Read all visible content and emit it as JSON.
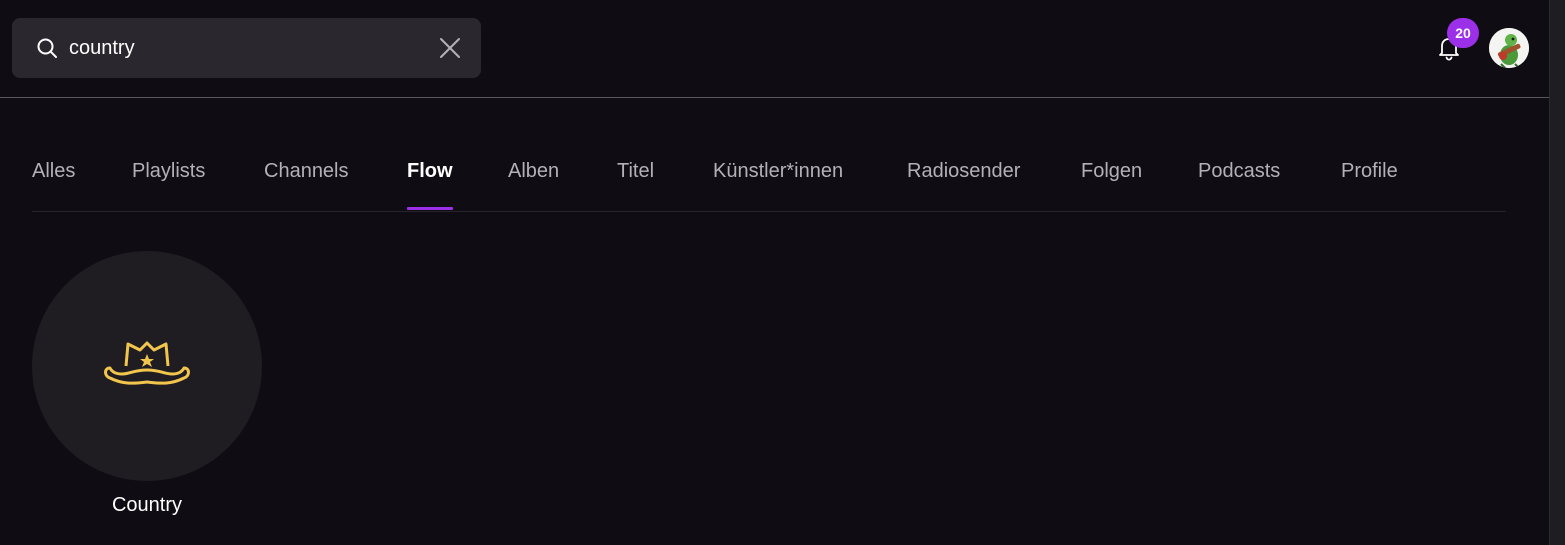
{
  "search": {
    "value": "country",
    "icon": "search-icon",
    "clear_icon": "close-icon"
  },
  "header": {
    "notifications_count": "20",
    "bell_icon": "bell-icon",
    "avatar_icon": "avatar-image"
  },
  "tabs": [
    {
      "label": "Alles",
      "active": false
    },
    {
      "label": "Playlists",
      "active": false
    },
    {
      "label": "Channels",
      "active": false
    },
    {
      "label": "Flow",
      "active": true
    },
    {
      "label": "Alben",
      "active": false
    },
    {
      "label": "Titel",
      "active": false
    },
    {
      "label": "Künstler*innen",
      "active": false
    },
    {
      "label": "Radiosender",
      "active": false
    },
    {
      "label": "Folgen",
      "active": false
    },
    {
      "label": "Podcasts",
      "active": false
    },
    {
      "label": "Profile",
      "active": false
    }
  ],
  "results": [
    {
      "label": "Country",
      "icon": "cowboy-hat-icon"
    }
  ],
  "colors": {
    "accent": "#9b30e8",
    "hat": "#f2c64d",
    "background": "#0f0d13"
  }
}
